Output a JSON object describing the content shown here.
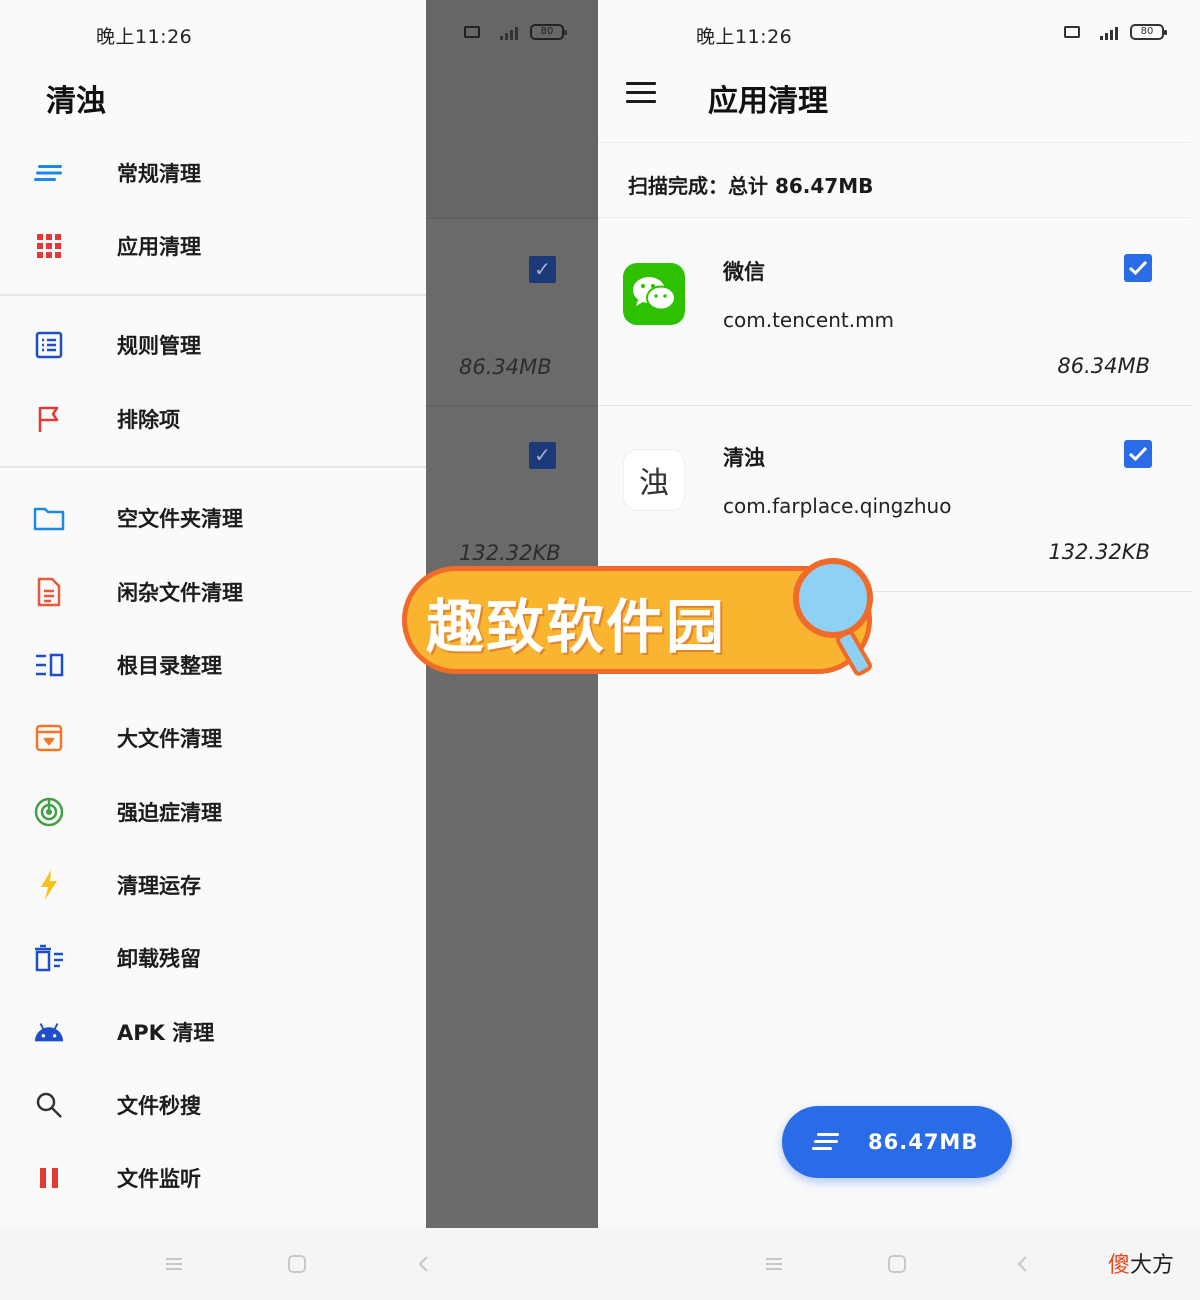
{
  "left_phone": {
    "status_time": "晚上11:26",
    "battery": "80",
    "drawer_title": "清浊",
    "menu": [
      {
        "label": "常规清理",
        "icon": "lines-icon"
      },
      {
        "label": "应用清理",
        "icon": "grid-icon"
      },
      {
        "label": "规则管理",
        "icon": "list-icon"
      },
      {
        "label": "排除项",
        "icon": "flag-icon"
      },
      {
        "label": "空文件夹清理",
        "icon": "folder-icon"
      },
      {
        "label": "闲杂文件清理",
        "icon": "document-icon"
      },
      {
        "label": "根目录整理",
        "icon": "root-dir-icon"
      },
      {
        "label": "大文件清理",
        "icon": "archive-icon"
      },
      {
        "label": "强迫症清理",
        "icon": "radar-icon"
      },
      {
        "label": "清理运存",
        "icon": "bolt-icon"
      },
      {
        "label": "卸载残留",
        "icon": "trash-list-icon"
      },
      {
        "label": "APK 清理",
        "icon": "android-icon"
      },
      {
        "label": "文件秒搜",
        "icon": "search-icon"
      },
      {
        "label": "文件监听",
        "icon": "pause-icon"
      }
    ],
    "behind_sizes": [
      "86.34MB",
      "132.32KB"
    ]
  },
  "right_phone": {
    "status_time": "晚上11:26",
    "battery": "80",
    "title": "应用清理",
    "scan_summary": "扫描完成：总计 86.47MB",
    "apps": [
      {
        "name": "微信",
        "package": "com.tencent.mm",
        "size": "86.34MB",
        "checked": true,
        "icon": "wechat-icon"
      },
      {
        "name": "清浊",
        "package": "com.farplace.qingzhuo",
        "size": "132.32KB",
        "checked": true,
        "icon": "qingzhuo-icon",
        "icon_text": "浊"
      }
    ],
    "fab_label": "86.47MB"
  },
  "watermark": {
    "banner_text": "趣致软件园",
    "corner_text_a": "傻",
    "corner_text_b": "大方"
  },
  "colors": {
    "accent": "#2a6be8",
    "wechat_green": "#2dc100",
    "scrim": "#6b6b6b"
  }
}
